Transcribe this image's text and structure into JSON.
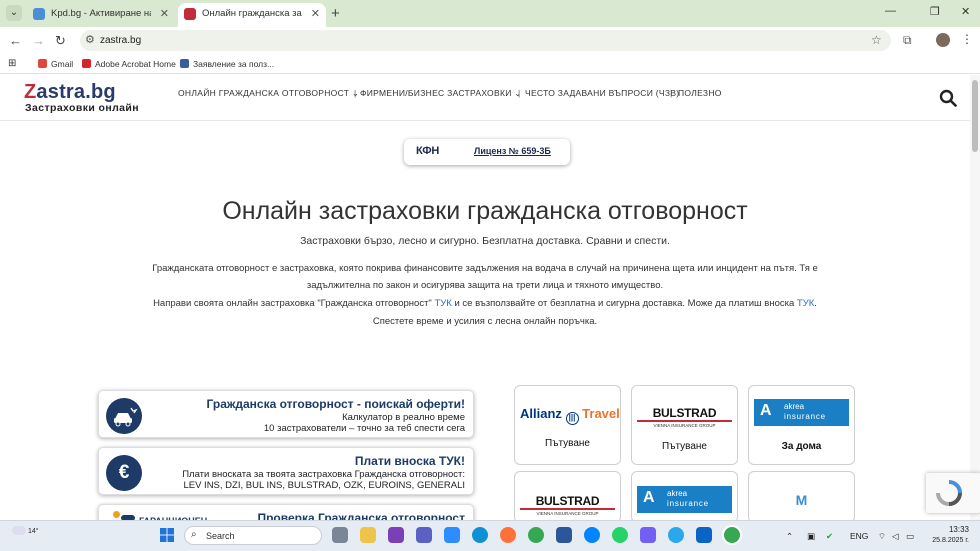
{
  "browser": {
    "tabs": [
      {
        "title": "Kpd.bg - Активиране на проф",
        "favicon_color": "#4a8fd6"
      },
      {
        "title": "Онлайн гражданска застрахов",
        "favicon_color": "#c22c3a"
      }
    ],
    "url": "zastra.bg",
    "bookmarks": [
      {
        "label": "Gmail"
      },
      {
        "label": "Adobe Acrobat Home"
      },
      {
        "label": "Заявление за полз..."
      }
    ]
  },
  "site": {
    "logo_main": "Zastra.bg",
    "logo_sub": "Застраховки онлайн",
    "menu": [
      "ОНЛАЙН ГРАЖДАНСКА ОТГОВОРНОСТ",
      "ФИРМЕНИ/БИЗНЕС ЗАСТРАХОВКИ",
      "ЧЕСТО ЗАДАВАНИ ВЪПРОСИ (ЧЗВ)",
      "ПОЛЕЗНО"
    ],
    "license_logo": "КФН",
    "license_text": "Лиценз № 659-3Б",
    "hero_title": "Онлайн застраховки гражданска отговорност",
    "hero_subtitle": "Застраховки бързо, лесно и сигурно. Безплатна доставка. Сравни и спести.",
    "para_line1": "Гражданската отговорност е застраховка, която покрива финансовите задължения на водача в случай на причинена щета или инцидент на пътя. Тя е",
    "para_line2": "задължителна по закон и осигурява защита на трети лица и тяхното имущество.",
    "para_line3_a": "Направи своята онлайн застраховка \"Гражданска отговорност\" ",
    "para_line3_link1": "ТУК",
    "para_line3_b": " и се възползвайте от безплатна и сигурна доставка. Може да платиш  вноска ",
    "para_line3_link2": "ТУК",
    "para_line3_c": ".",
    "para_line4": "Спестете време и усилия с лесна онлайн поръчка.",
    "actions": [
      {
        "title": "Гражданска отговорност - поискай оферти!",
        "line1": "Калкулатор в реално време",
        "line2": "10 застрахователи – точно за теб спести сега",
        "icon": "car-crash-icon"
      },
      {
        "title": "Плати вноска ТУК!",
        "line1": "Плати вноската за твоята застраховка Гражданска отговорност:",
        "line2": "LEV INS, DZI, BUL INS, BULSTRAD, OZK, EUROINS, GENERALI",
        "icon": "euro-icon"
      },
      {
        "title": "Проверка Гражданска отговорност",
        "icon": "person-check-icon"
      }
    ],
    "insurers": [
      {
        "logo": "Allianz",
        "logo_sub": "Travel",
        "label": "Пътуване"
      },
      {
        "logo": "BULSTRAD",
        "logo_sub": "VIENNA INSURANCE GROUP",
        "label": "Пътуване"
      },
      {
        "logo": "akrea",
        "logo_sub": "insurance",
        "label": "За дома"
      },
      {
        "logo": "BULSTRAD",
        "logo_sub": "VIENNA INSURANCE GROUP",
        "label": ""
      },
      {
        "logo": "akrea",
        "logo_sub": "insurance",
        "label": ""
      },
      {
        "logo": "M",
        "logo_sub": "",
        "label": ""
      }
    ]
  },
  "taskbar": {
    "weather": "14°",
    "search_placeholder": "Search",
    "lang": "ENG",
    "time": "13:33",
    "date": "25.8.2025 г."
  },
  "colors": {
    "brand_navy": "#1d3b66",
    "brand_red": "#c22c3a",
    "link": "#2a6fc5",
    "akrea_blue": "#1a7fc4"
  }
}
